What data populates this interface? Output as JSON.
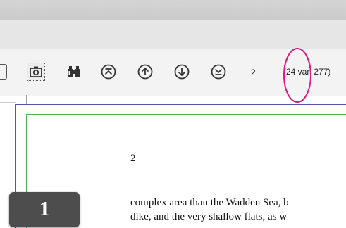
{
  "toolbar": {
    "page_input_value": "2",
    "page_count_label": "(24 van 277)",
    "buttons": [
      {
        "icon": "camera-icon",
        "name": "snapshot-button"
      },
      {
        "icon": "binoculars-icon",
        "name": "find-button"
      },
      {
        "icon": "arrow-first-icon",
        "name": "first-page-button"
      },
      {
        "icon": "arrow-up-icon",
        "name": "previous-page-button"
      },
      {
        "icon": "arrow-down-icon",
        "name": "next-page-button"
      },
      {
        "icon": "arrow-last-icon",
        "name": "last-page-button"
      }
    ],
    "annotation_color": "#e0197a"
  },
  "document": {
    "header_page_number": "2",
    "body_lines": [
      "complex area than the Wadden Sea, b",
      "dike, and the very shallow flats, as w"
    ],
    "margin_guide_colors": {
      "outer": "#5b55a8",
      "inner": "#45b845"
    }
  },
  "page_badge": {
    "label": "1"
  }
}
